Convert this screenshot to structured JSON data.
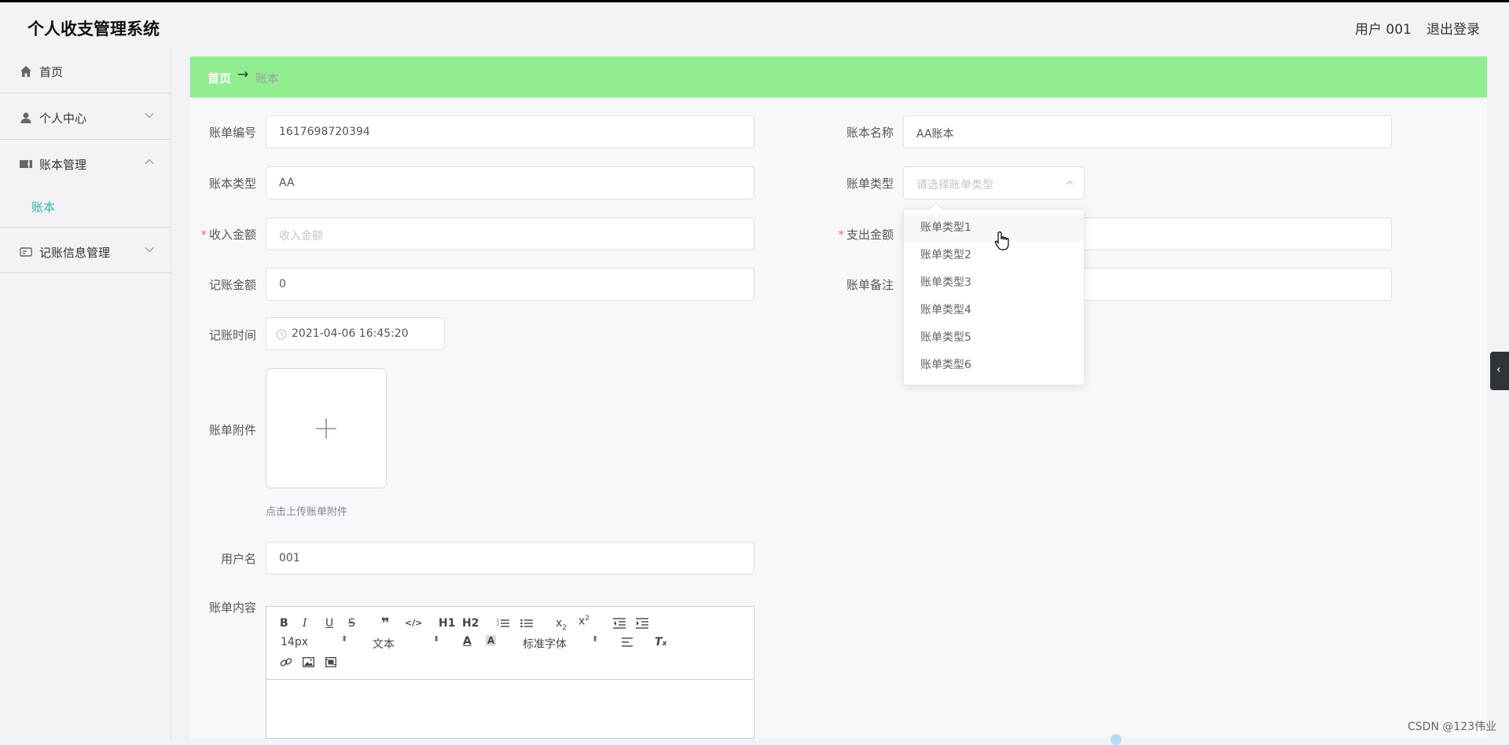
{
  "app": {
    "title": "个人收支管理系统"
  },
  "header": {
    "user": "用户 001",
    "logout": "退出登录"
  },
  "sidebar": {
    "items": [
      {
        "label": "首页",
        "icon": "home-icon"
      },
      {
        "label": "个人中心",
        "icon": "user-icon"
      },
      {
        "label": "账本管理",
        "icon": "ticket-icon",
        "expanded": true
      },
      {
        "label": "记账信息管理",
        "icon": "card-icon"
      }
    ],
    "submenu": {
      "label": "账本"
    }
  },
  "breadcrumb": {
    "home": "首页",
    "separator": "→",
    "current": "账本"
  },
  "form": {
    "bill_no": {
      "label": "账单编号",
      "value": "1617698720394"
    },
    "book_name": {
      "label": "账本名称",
      "value": "AA账本"
    },
    "book_type": {
      "label": "账本类型",
      "value": "AA"
    },
    "bill_type": {
      "label": "账单类型",
      "placeholder": "请选择账单类型"
    },
    "income": {
      "label": "收入金额",
      "placeholder": "收入金额"
    },
    "expense": {
      "label": "支出金额"
    },
    "amount": {
      "label": "记账金额",
      "value": "0"
    },
    "remark": {
      "label": "账单备注"
    },
    "time": {
      "label": "记账时间",
      "value": "2021-04-06 16:45:20"
    },
    "attachment": {
      "label": "账单附件",
      "tip": "点击上传账单附件"
    },
    "username": {
      "label": "用户名",
      "value": "001"
    },
    "content": {
      "label": "账单内容"
    }
  },
  "dropdown": {
    "options": [
      "账单类型1",
      "账单类型2",
      "账单类型3",
      "账单类型4",
      "账单类型5",
      "账单类型6"
    ],
    "hovered": 0
  },
  "editor": {
    "font_size": "14px",
    "text_style": "文本",
    "font_family": "标准字体",
    "h1": "H1",
    "h2": "H2"
  },
  "watermark": "CSDN @123伟业",
  "colors": {
    "breadcrumb_bg": "#90ee90",
    "submenu_active": "#2bb5a7",
    "required": "#f56c6c"
  }
}
